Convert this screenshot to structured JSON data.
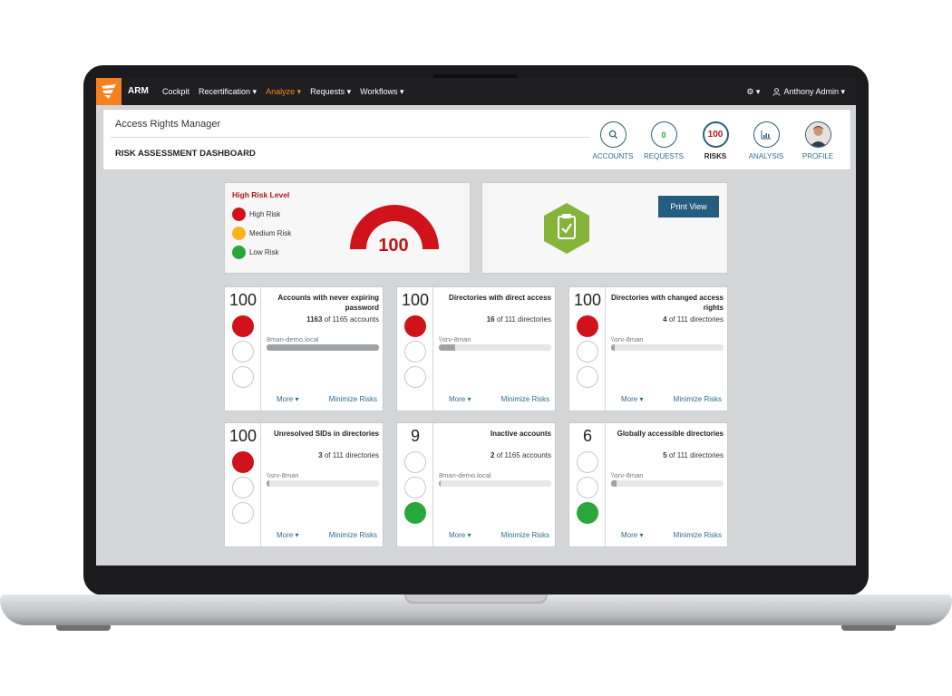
{
  "topbar": {
    "app_name": "ARM",
    "nav": [
      {
        "label": "Cockpit"
      },
      {
        "label": "Recertification ▾"
      },
      {
        "label": "Analyze ▾"
      },
      {
        "label": "Requests ▾"
      },
      {
        "label": "Workflows ▾"
      }
    ],
    "settings_label": "⚙ ▾",
    "user_label": "Anthony Admin ▾"
  },
  "header": {
    "app_title": "Access Rights Manager",
    "dashboard_title": "RISK ASSESSMENT DASHBOARD",
    "nav": [
      {
        "label": "ACCOUNTS",
        "icon": "search-icon"
      },
      {
        "label": "REQUESTS",
        "value": "0"
      },
      {
        "label": "RISKS",
        "value": "100"
      },
      {
        "label": "ANALYSIS",
        "icon": "chart-icon"
      },
      {
        "label": "PROFILE",
        "icon": "avatar"
      }
    ]
  },
  "risk_panel": {
    "title": "High Risk Level",
    "legend": [
      {
        "label": "High Risk",
        "color": "#d0121a"
      },
      {
        "label": "Medium Risk",
        "color": "#f7b51b"
      },
      {
        "label": "Low Risk",
        "color": "#28a83a"
      }
    ],
    "gauge_value": "100",
    "gauge_level": 1.0
  },
  "print_panel": {
    "button_label": "Print View",
    "icon": "clipboard-check-icon"
  },
  "cards": [
    {
      "score": "100",
      "level": "high",
      "title": "Accounts with never expiring password",
      "count_bold": "1163",
      "count_rest": " of 1165 accounts",
      "domain": "8man-demo.local",
      "progress": 0.998,
      "more": "More ▾",
      "minimize": "Minimize Risks"
    },
    {
      "score": "100",
      "level": "high",
      "title": "Directories with direct access",
      "count_bold": "16",
      "count_rest": " of 111 directories",
      "domain": "\\\\srv-8man",
      "progress": 0.144,
      "more": "More ▾",
      "minimize": "Minimize Risks"
    },
    {
      "score": "100",
      "level": "high",
      "title": "Directories with changed access rights",
      "count_bold": "4",
      "count_rest": " of 111 directories",
      "domain": "\\\\srv-8man",
      "progress": 0.036,
      "more": "More ▾",
      "minimize": "Minimize Risks"
    },
    {
      "score": "100",
      "level": "high",
      "title": "Unresolved SIDs in directories",
      "count_bold": "3",
      "count_rest": " of 111 directories",
      "domain": "\\\\srv-8man",
      "progress": 0.027,
      "more": "More ▾",
      "minimize": "Minimize Risks"
    },
    {
      "score": "9",
      "level": "low",
      "title": "Inactive accounts",
      "count_bold": "2",
      "count_rest": " of 1165 accounts",
      "domain": "8man-demo.local",
      "progress": 0.002,
      "more": "More ▾",
      "minimize": "Minimize Risks"
    },
    {
      "score": "6",
      "level": "low",
      "title": "Globally accessible directories",
      "count_bold": "5",
      "count_rest": " of 111 directories",
      "domain": "\\\\srv-8man",
      "progress": 0.045,
      "more": "More ▾",
      "minimize": "Minimize Risks"
    }
  ],
  "colors": {
    "high": "#d0121a",
    "medium": "#f7b51b",
    "low": "#28a83a",
    "accent": "#f5821f",
    "link": "#2d6d8f"
  }
}
